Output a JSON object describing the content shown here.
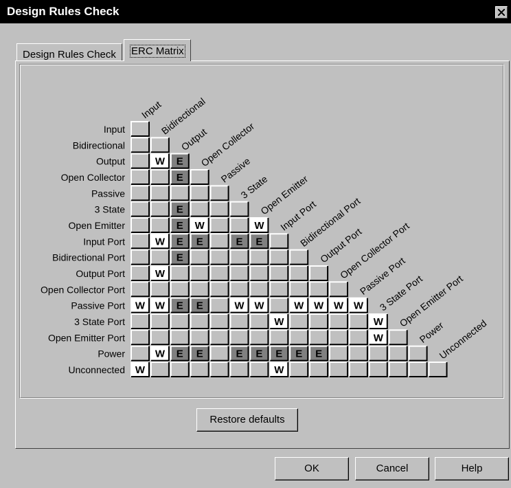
{
  "window": {
    "title": "Design Rules Check"
  },
  "tabs": [
    {
      "label": "Design Rules Check",
      "active": false
    },
    {
      "label": "ERC Matrix",
      "active": true
    }
  ],
  "matrix": {
    "pin_types": [
      "Input",
      "Bidirectional",
      "Output",
      "Open Collector",
      "Passive",
      "3 State",
      "Open Emitter",
      "Input Port",
      "Bidirectional Port",
      "Output Port",
      "Open Collector Port",
      "Passive Port",
      "3 State Port",
      "Open Emitter Port",
      "Power",
      "Unconnected"
    ],
    "rows": [
      [
        ""
      ],
      [
        "",
        ""
      ],
      [
        "",
        "W",
        "E"
      ],
      [
        "",
        "",
        "E",
        ""
      ],
      [
        "",
        "",
        "",
        "",
        ""
      ],
      [
        "",
        "",
        "E",
        "",
        "",
        ""
      ],
      [
        "",
        "",
        "E",
        "W",
        "",
        "",
        "W"
      ],
      [
        "",
        "W",
        "E",
        "E",
        "",
        "E",
        "E",
        ""
      ],
      [
        "",
        "",
        "E",
        "",
        "",
        "",
        "",
        "",
        ""
      ],
      [
        "",
        "W",
        "",
        "",
        "",
        "",
        "",
        "",
        "",
        ""
      ],
      [
        "",
        "",
        "",
        "",
        "",
        "",
        "",
        "",
        "",
        "",
        ""
      ],
      [
        "W",
        "W",
        "E",
        "E",
        "",
        "W",
        "W",
        "",
        "W",
        "W",
        "W",
        "W"
      ],
      [
        "",
        "",
        "",
        "",
        "",
        "",
        "",
        "W",
        "",
        "",
        "",
        "",
        "W"
      ],
      [
        "",
        "",
        "",
        "",
        "",
        "",
        "",
        "",
        "",
        "",
        "",
        "",
        "W",
        ""
      ],
      [
        "",
        "W",
        "E",
        "E",
        "",
        "E",
        "E",
        "E",
        "E",
        "E",
        "",
        "",
        "",
        "",
        ""
      ],
      [
        "W",
        "",
        "",
        "",
        "",
        "",
        "",
        "W",
        "",
        "",
        "",
        "",
        "",
        "",
        "",
        ""
      ]
    ],
    "colors": {
      "error": "#808080",
      "warning": "#ffffff",
      "none": "#c0c0c0"
    }
  },
  "buttons": {
    "restore": "Restore defaults",
    "ok": "OK",
    "cancel": "Cancel",
    "help": "Help"
  }
}
